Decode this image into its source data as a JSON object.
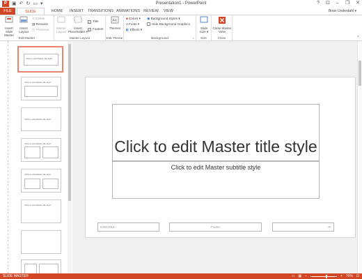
{
  "window": {
    "title": "Presentation1 - PowerPoint",
    "app_logo": "P"
  },
  "tabs": [
    "FILE",
    "SLIDE MASTER",
    "HOME",
    "INSERT",
    "TRANSITIONS",
    "ANIMATIONS",
    "REVIEW",
    "VIEW"
  ],
  "user": "Brian Underdahl ▾",
  "ribbon": {
    "edit_master": {
      "insert_slide_master": "Insert Slide Master",
      "insert_layout": "Insert Layout",
      "delete": "Delete",
      "rename": "Rename",
      "preserve": "Preserve",
      "label": "Edit Master"
    },
    "master_layout": {
      "master_layout": "Master Layout",
      "insert_placeholder": "Insert Placeholder ▾",
      "title": "Title",
      "footers": "Footers",
      "label": "Master Layout"
    },
    "edit_theme": {
      "themes": "Themes",
      "label": "Edit Theme"
    },
    "background": {
      "colors": "Colors ▾",
      "fonts": "Fonts ▾",
      "effects": "Effects ▾",
      "background_styles": "Background Styles ▾",
      "hide_bg": "Hide Background Graphics",
      "label": "Background"
    },
    "size": {
      "slide_size": "Slide Size ▾",
      "label": "Size"
    },
    "close": {
      "close_master_view": "Close Master View",
      "label": "Close"
    }
  },
  "slide": {
    "title": "Click to edit Master title style",
    "subtitle": "Click to edit Master subtitle style",
    "date": "5/28/2013",
    "footer": "Footer",
    "page_number": "‹#›"
  },
  "thumb_text": {
    "master": "Click to edit Master title style",
    "layout": "Click to edit Master title style"
  },
  "status": {
    "left": "SLIDE MASTER",
    "zoom": "76%"
  },
  "colors": {
    "accent": "#d24726"
  }
}
